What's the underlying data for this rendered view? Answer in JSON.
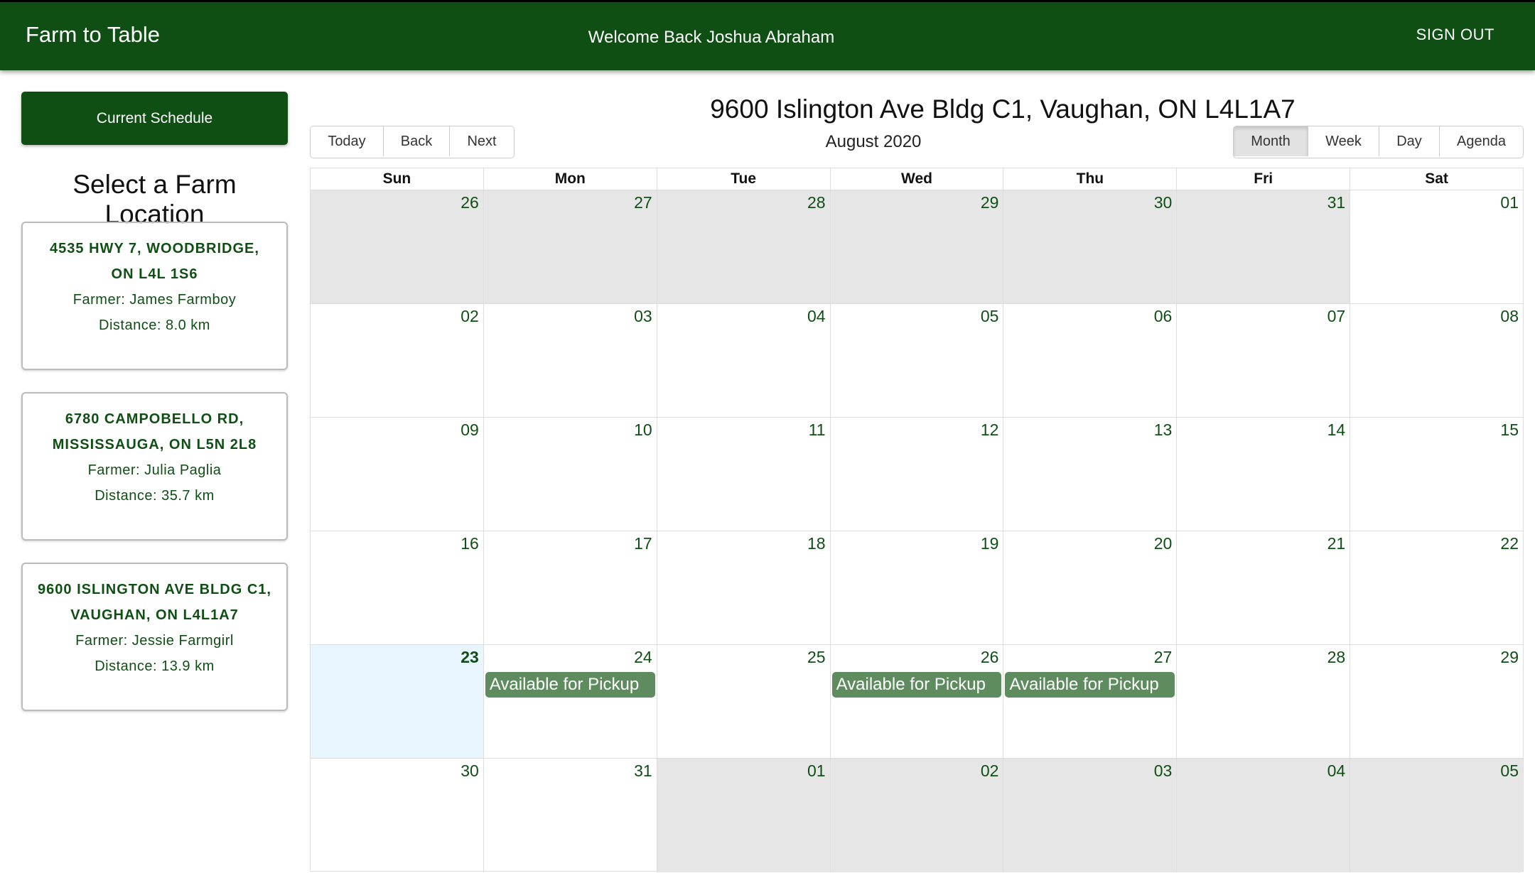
{
  "header": {
    "brand": "Farm to Table",
    "welcome": "Welcome Back Joshua Abraham",
    "signout": "SIGN OUT"
  },
  "sidebar": {
    "current_schedule": "Current Schedule",
    "select_title": "Select a Farm Location",
    "farms": [
      {
        "address": "4535 HWY 7, WOODBRIDGE, ON L4L 1S6",
        "farmer": "Farmer: James Farmboy",
        "distance": "Distance: 8.0 km"
      },
      {
        "address": "6780 CAMPOBELLO RD, MISSISSAUGA, ON L5N 2L8",
        "farmer": "Farmer: Julia Paglia",
        "distance": "Distance: 35.7 km"
      },
      {
        "address": "9600 ISLINGTON AVE BLDG C1, VAUGHAN, ON L4L1A7",
        "farmer": "Farmer: Jessie Farmgirl",
        "distance": "Distance: 13.9 km"
      }
    ]
  },
  "calendar": {
    "location_title": "9600 Islington Ave Bldg C1, Vaughan, ON L4L1A7",
    "month_label": "August 2020",
    "nav_buttons": [
      "Today",
      "Back",
      "Next"
    ],
    "view_buttons": [
      "Month",
      "Week",
      "Day",
      "Agenda"
    ],
    "active_view": "Month",
    "weekdays": [
      "Sun",
      "Mon",
      "Tue",
      "Wed",
      "Thu",
      "Fri",
      "Sat"
    ],
    "weeks": [
      [
        {
          "d": "26",
          "off": true
        },
        {
          "d": "27",
          "off": true
        },
        {
          "d": "28",
          "off": true
        },
        {
          "d": "29",
          "off": true
        },
        {
          "d": "30",
          "off": true
        },
        {
          "d": "31",
          "off": true
        },
        {
          "d": "01"
        }
      ],
      [
        {
          "d": "02"
        },
        {
          "d": "03"
        },
        {
          "d": "04"
        },
        {
          "d": "05"
        },
        {
          "d": "06"
        },
        {
          "d": "07"
        },
        {
          "d": "08"
        }
      ],
      [
        {
          "d": "09"
        },
        {
          "d": "10"
        },
        {
          "d": "11"
        },
        {
          "d": "12"
        },
        {
          "d": "13"
        },
        {
          "d": "14"
        },
        {
          "d": "15"
        }
      ],
      [
        {
          "d": "16"
        },
        {
          "d": "17"
        },
        {
          "d": "18"
        },
        {
          "d": "19"
        },
        {
          "d": "20"
        },
        {
          "d": "21"
        },
        {
          "d": "22"
        }
      ],
      [
        {
          "d": "23",
          "today": true
        },
        {
          "d": "24",
          "event": "Available for Pickup"
        },
        {
          "d": "25"
        },
        {
          "d": "26",
          "event": "Available for Pickup"
        },
        {
          "d": "27",
          "event": "Available for Pickup"
        },
        {
          "d": "28"
        },
        {
          "d": "29"
        }
      ],
      [
        {
          "d": "30"
        },
        {
          "d": "31"
        },
        {
          "d": "01",
          "off": true
        },
        {
          "d": "02",
          "off": true
        },
        {
          "d": "03",
          "off": true
        },
        {
          "d": "04",
          "off": true
        },
        {
          "d": "05",
          "off": true
        }
      ]
    ]
  },
  "colors": {
    "brand_green": "#0f4f14",
    "event_green": "#5e8c5f",
    "today_bg": "#eaf6ff",
    "off_range_bg": "#e6e6e6"
  }
}
